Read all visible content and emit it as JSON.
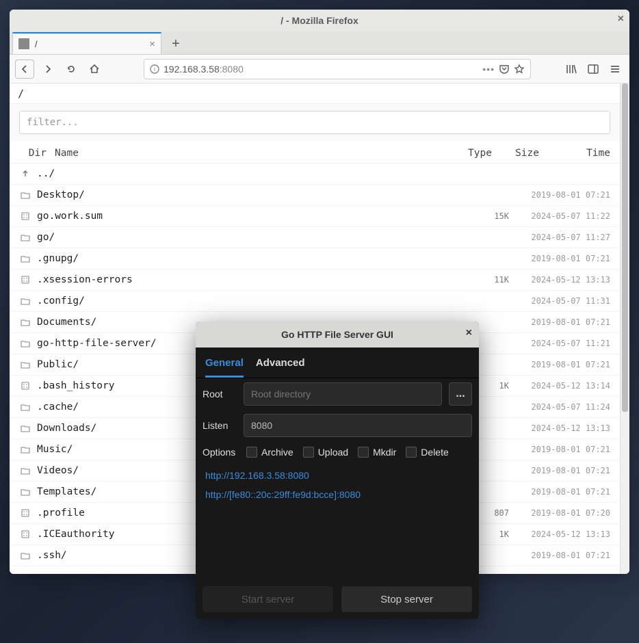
{
  "window": {
    "title": "/ - Mozilla Firefox",
    "tab_title": "/"
  },
  "urlbar": {
    "host": "192.168.3.58",
    "port": ":8080"
  },
  "breadcrumb": "/",
  "filter_placeholder": "filter...",
  "columns": {
    "dir": "Dir",
    "name": "Name",
    "type": "Type",
    "size": "Size",
    "time": "Time"
  },
  "rows": [
    {
      "icon": "up",
      "name": "../",
      "size": "",
      "time": ""
    },
    {
      "icon": "dir",
      "name": "Desktop/",
      "size": "",
      "time": "2019-08-01 07:21"
    },
    {
      "icon": "file",
      "name": "go.work.sum",
      "size": "15K",
      "time": "2024-05-07 11:22"
    },
    {
      "icon": "dir",
      "name": "go/",
      "size": "",
      "time": "2024-05-07 11:27"
    },
    {
      "icon": "dir",
      "name": ".gnupg/",
      "size": "",
      "time": "2019-08-01 07:21"
    },
    {
      "icon": "file",
      "name": ".xsession-errors",
      "size": "11K",
      "time": "2024-05-12 13:13"
    },
    {
      "icon": "dir",
      "name": ".config/",
      "size": "",
      "time": "2024-05-07 11:31"
    },
    {
      "icon": "dir",
      "name": "Documents/",
      "size": "",
      "time": "2019-08-01 07:21"
    },
    {
      "icon": "dir",
      "name": "go-http-file-server/",
      "size": "",
      "time": "2024-05-07 11:21"
    },
    {
      "icon": "dir",
      "name": "Public/",
      "size": "",
      "time": "2019-08-01 07:21"
    },
    {
      "icon": "file",
      "name": ".bash_history",
      "size": "1K",
      "time": "2024-05-12 13:14"
    },
    {
      "icon": "dir",
      "name": ".cache/",
      "size": "",
      "time": "2024-05-07 11:24"
    },
    {
      "icon": "dir",
      "name": "Downloads/",
      "size": "",
      "time": "2024-05-12 13:13"
    },
    {
      "icon": "dir",
      "name": "Music/",
      "size": "",
      "time": "2019-08-01 07:21"
    },
    {
      "icon": "dir",
      "name": "Videos/",
      "size": "",
      "time": "2019-08-01 07:21"
    },
    {
      "icon": "dir",
      "name": "Templates/",
      "size": "",
      "time": "2019-08-01 07:21"
    },
    {
      "icon": "file",
      "name": ".profile",
      "size": "807",
      "time": "2019-08-01 07:20"
    },
    {
      "icon": "file",
      "name": ".ICEauthority",
      "size": "1K",
      "time": "2024-05-12 13:13"
    },
    {
      "icon": "dir",
      "name": ".ssh/",
      "size": "",
      "time": "2019-08-01 07:21"
    }
  ],
  "dialog": {
    "title": "Go HTTP File Server GUI",
    "tabs": {
      "general": "General",
      "advanced": "Advanced"
    },
    "root_label": "Root",
    "root_placeholder": "Root directory",
    "browse": "...",
    "listen_label": "Listen",
    "listen_value": "8080",
    "options_label": "Options",
    "opts": {
      "archive": "Archive",
      "upload": "Upload",
      "mkdir": "Mkdir",
      "delete": "Delete"
    },
    "link1": "http://192.168.3.58:8080",
    "link2": "http://[fe80::20c:29ff:fe9d:bcce]:8080",
    "start": "Start server",
    "stop": "Stop server"
  }
}
